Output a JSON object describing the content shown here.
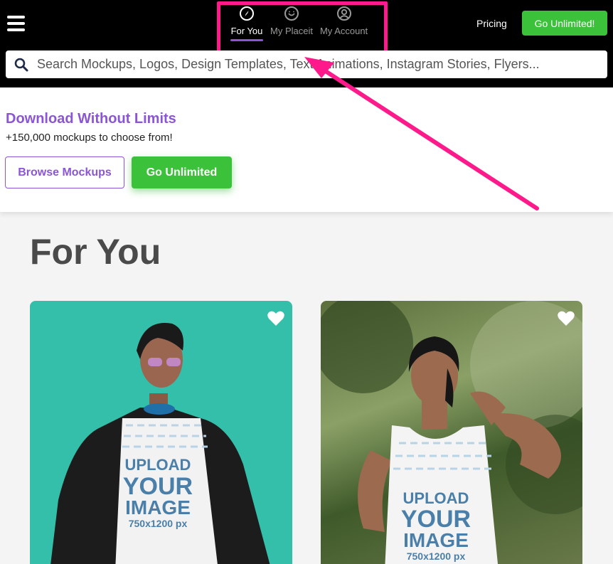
{
  "header": {
    "nav_tabs": [
      {
        "label": "For You",
        "icon": "compass-icon",
        "active": true
      },
      {
        "label": "My Placeit",
        "icon": "smiley-icon",
        "active": false
      },
      {
        "label": "My Account",
        "icon": "user-circle-icon",
        "active": false
      }
    ],
    "pricing_label": "Pricing",
    "unlimited_label": "Go Unlimited!",
    "search_placeholder": "Search Mockups, Logos, Design Templates, Text Animations, Instagram Stories, Flyers..."
  },
  "promo": {
    "title": "Download Without Limits",
    "subtitle": "+150,000 mockups to choose from!",
    "browse_label": "Browse Mockups",
    "unlimited_label": "Go Unlimited"
  },
  "main": {
    "section_title": "For You",
    "cards": [
      {
        "image_text_1": "UPLOAD",
        "image_text_2": "YOUR",
        "image_text_3": "IMAGE",
        "image_text_4": "750x1200 px"
      },
      {
        "image_text_1": "UPLOAD",
        "image_text_2": "YOUR",
        "image_text_3": "IMAGE",
        "image_text_4": "750x1200 px"
      }
    ]
  },
  "colors": {
    "brand_purple": "#8a55d6",
    "cta_green": "#3cc13b",
    "annotation_pink": "#ff1a8c",
    "card1_bg": "#33bfaa"
  }
}
